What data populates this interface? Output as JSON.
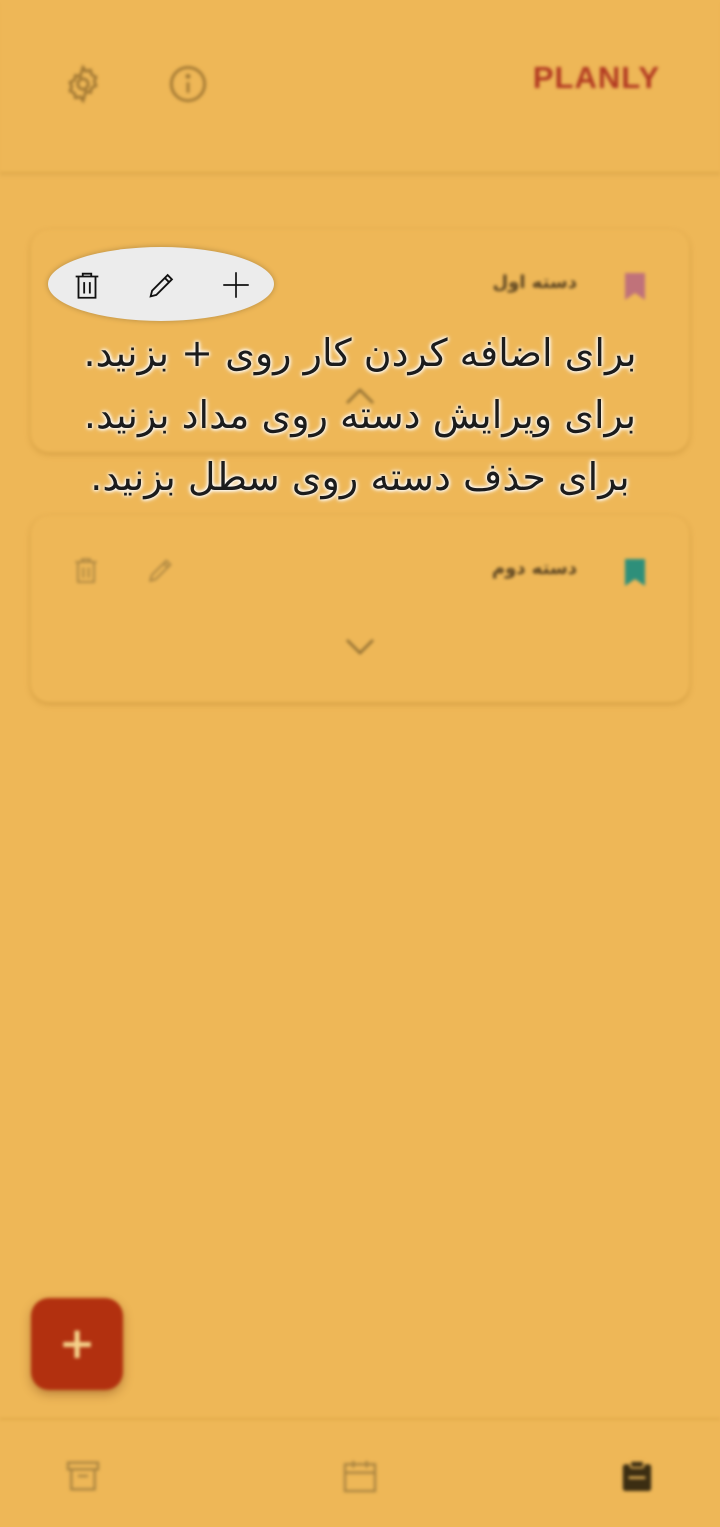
{
  "app": {
    "brand": "PLANLY"
  },
  "header": {
    "settings_icon": "gear-icon",
    "info_icon": "info-icon"
  },
  "categories": [
    {
      "title": "دسته اول",
      "bookmark_color": "#c0727a",
      "expanded": true
    },
    {
      "title": "دسته دوم",
      "bookmark_color": "#2e8f7a",
      "expanded": false
    }
  ],
  "tooltip": {
    "actions": [
      "trash-icon",
      "pencil-icon",
      "plus-icon"
    ],
    "lines": [
      "برای اضافه کردن کار روی + بزنید.",
      "برای ویرایش دسته روی مداد بزنید.",
      "برای حذف دسته روی سطل بزنید."
    ]
  },
  "fab": {
    "glyph": "+"
  },
  "bottom_nav": [
    "archive-icon",
    "calendar-icon",
    "clipboard-icon"
  ],
  "colors": {
    "background": "#eeb757",
    "brand": "#b23a22",
    "fab": "#b2300f"
  }
}
